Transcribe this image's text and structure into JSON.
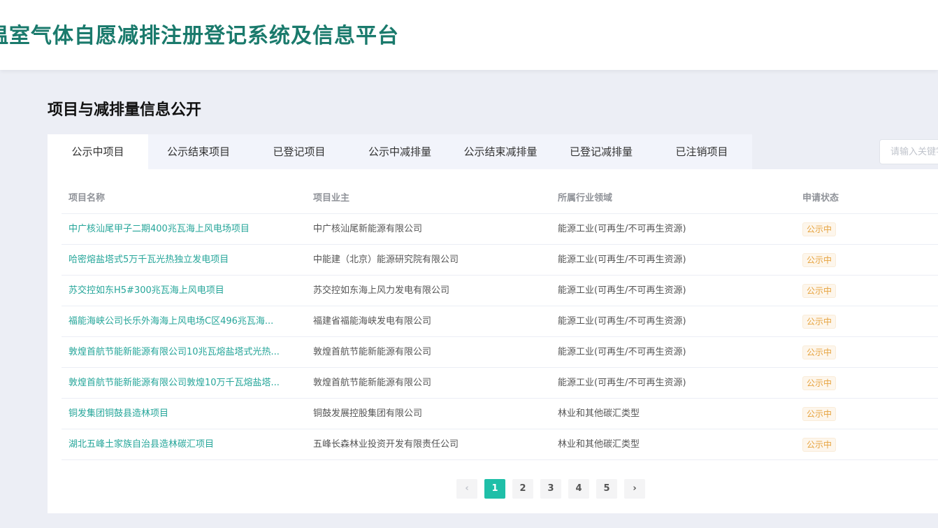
{
  "header": {
    "title": "温室气体自愿减排注册登记系统及信息平台"
  },
  "section": {
    "title": "项目与减排量信息公开"
  },
  "tabs": [
    {
      "label": "公示中项目",
      "active": true
    },
    {
      "label": "公示结束项目",
      "active": false
    },
    {
      "label": "已登记项目",
      "active": false
    },
    {
      "label": "公示中减排量",
      "active": false
    },
    {
      "label": "公示结束减排量",
      "active": false
    },
    {
      "label": "已登记减排量",
      "active": false
    },
    {
      "label": "已注销项目",
      "active": false
    }
  ],
  "search": {
    "placeholder": "请输入关键字"
  },
  "table": {
    "columns": [
      "项目名称",
      "项目业主",
      "所属行业领域",
      "申请状态"
    ],
    "rows": [
      {
        "name": "中广核汕尾甲子二期400兆瓦海上风电场项目",
        "owner": "中广核汕尾新能源有限公司",
        "industry": "能源工业(可再生/不可再生资源)",
        "status": "公示中"
      },
      {
        "name": "哈密熔盐塔式5万千瓦光热独立发电项目",
        "owner": "中能建（北京）能源研究院有限公司",
        "industry": "能源工业(可再生/不可再生资源)",
        "status": "公示中"
      },
      {
        "name": "苏交控如东H5#300兆瓦海上风电项目",
        "owner": "苏交控如东海上风力发电有限公司",
        "industry": "能源工业(可再生/不可再生资源)",
        "status": "公示中"
      },
      {
        "name": "福能海峡公司长乐外海海上风电场C区496兆瓦海...",
        "owner": "福建省福能海峡发电有限公司",
        "industry": "能源工业(可再生/不可再生资源)",
        "status": "公示中"
      },
      {
        "name": "敦煌首航节能新能源有限公司10兆瓦熔盐塔式光热...",
        "owner": "敦煌首航节能新能源有限公司",
        "industry": "能源工业(可再生/不可再生资源)",
        "status": "公示中"
      },
      {
        "name": "敦煌首航节能新能源有限公司敦煌10万千瓦熔盐塔...",
        "owner": "敦煌首航节能新能源有限公司",
        "industry": "能源工业(可再生/不可再生资源)",
        "status": "公示中"
      },
      {
        "name": "铜发集团铜鼓县造林项目",
        "owner": "铜鼓发展控股集团有限公司",
        "industry": "林业和其他碳汇类型",
        "status": "公示中"
      },
      {
        "name": "湖北五峰土家族自治县造林碳汇项目",
        "owner": "五峰长森林业投资开发有限责任公司",
        "industry": "林业和其他碳汇类型",
        "status": "公示中"
      }
    ]
  },
  "pagination": {
    "prev": "‹",
    "next": "›",
    "pages": [
      "1",
      "2",
      "3",
      "4",
      "5"
    ],
    "current": "1"
  }
}
